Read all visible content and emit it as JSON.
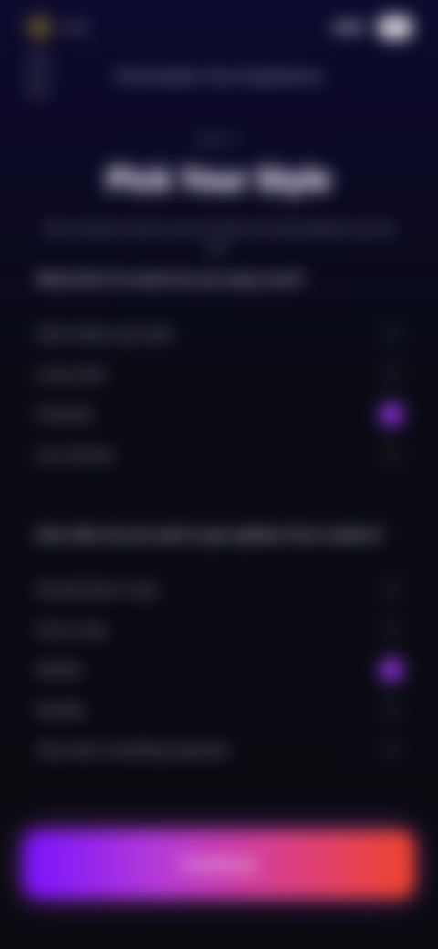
{
  "status_bar": {
    "time": "9:41"
  },
  "header": {
    "title": "Personalize Your Experience"
  },
  "hero": {
    "eyebrow": "STEP 1",
    "title": "Pick Your Style",
    "subtitle": "Tell us what you like so we can tailor recommendations just for you."
  },
  "sections": [
    {
      "heading": "What kind of content do you enjoy most?",
      "options": [
        {
          "label": "Short videos and reels",
          "selected": false
        },
        {
          "label": "Long reads",
          "selected": false
        },
        {
          "label": "Podcasts",
          "selected": true
        },
        {
          "label": "Live streams",
          "selected": false
        }
      ]
    },
    {
      "heading": "How often do you want to get updates from creators?",
      "options": [
        {
          "label": "Several times a day",
          "selected": false
        },
        {
          "label": "Once a day",
          "selected": false
        },
        {
          "label": "Weekly",
          "selected": true
        },
        {
          "label": "Monthly",
          "selected": false
        },
        {
          "label": "Only when something important",
          "selected": false
        }
      ]
    }
  ],
  "cta": {
    "label": "Continue"
  },
  "colors": {
    "accent_start": "#7a12ff",
    "accent_end": "#f0442a",
    "radio_selected": "#9b3cff",
    "background": "#0a0b10"
  }
}
